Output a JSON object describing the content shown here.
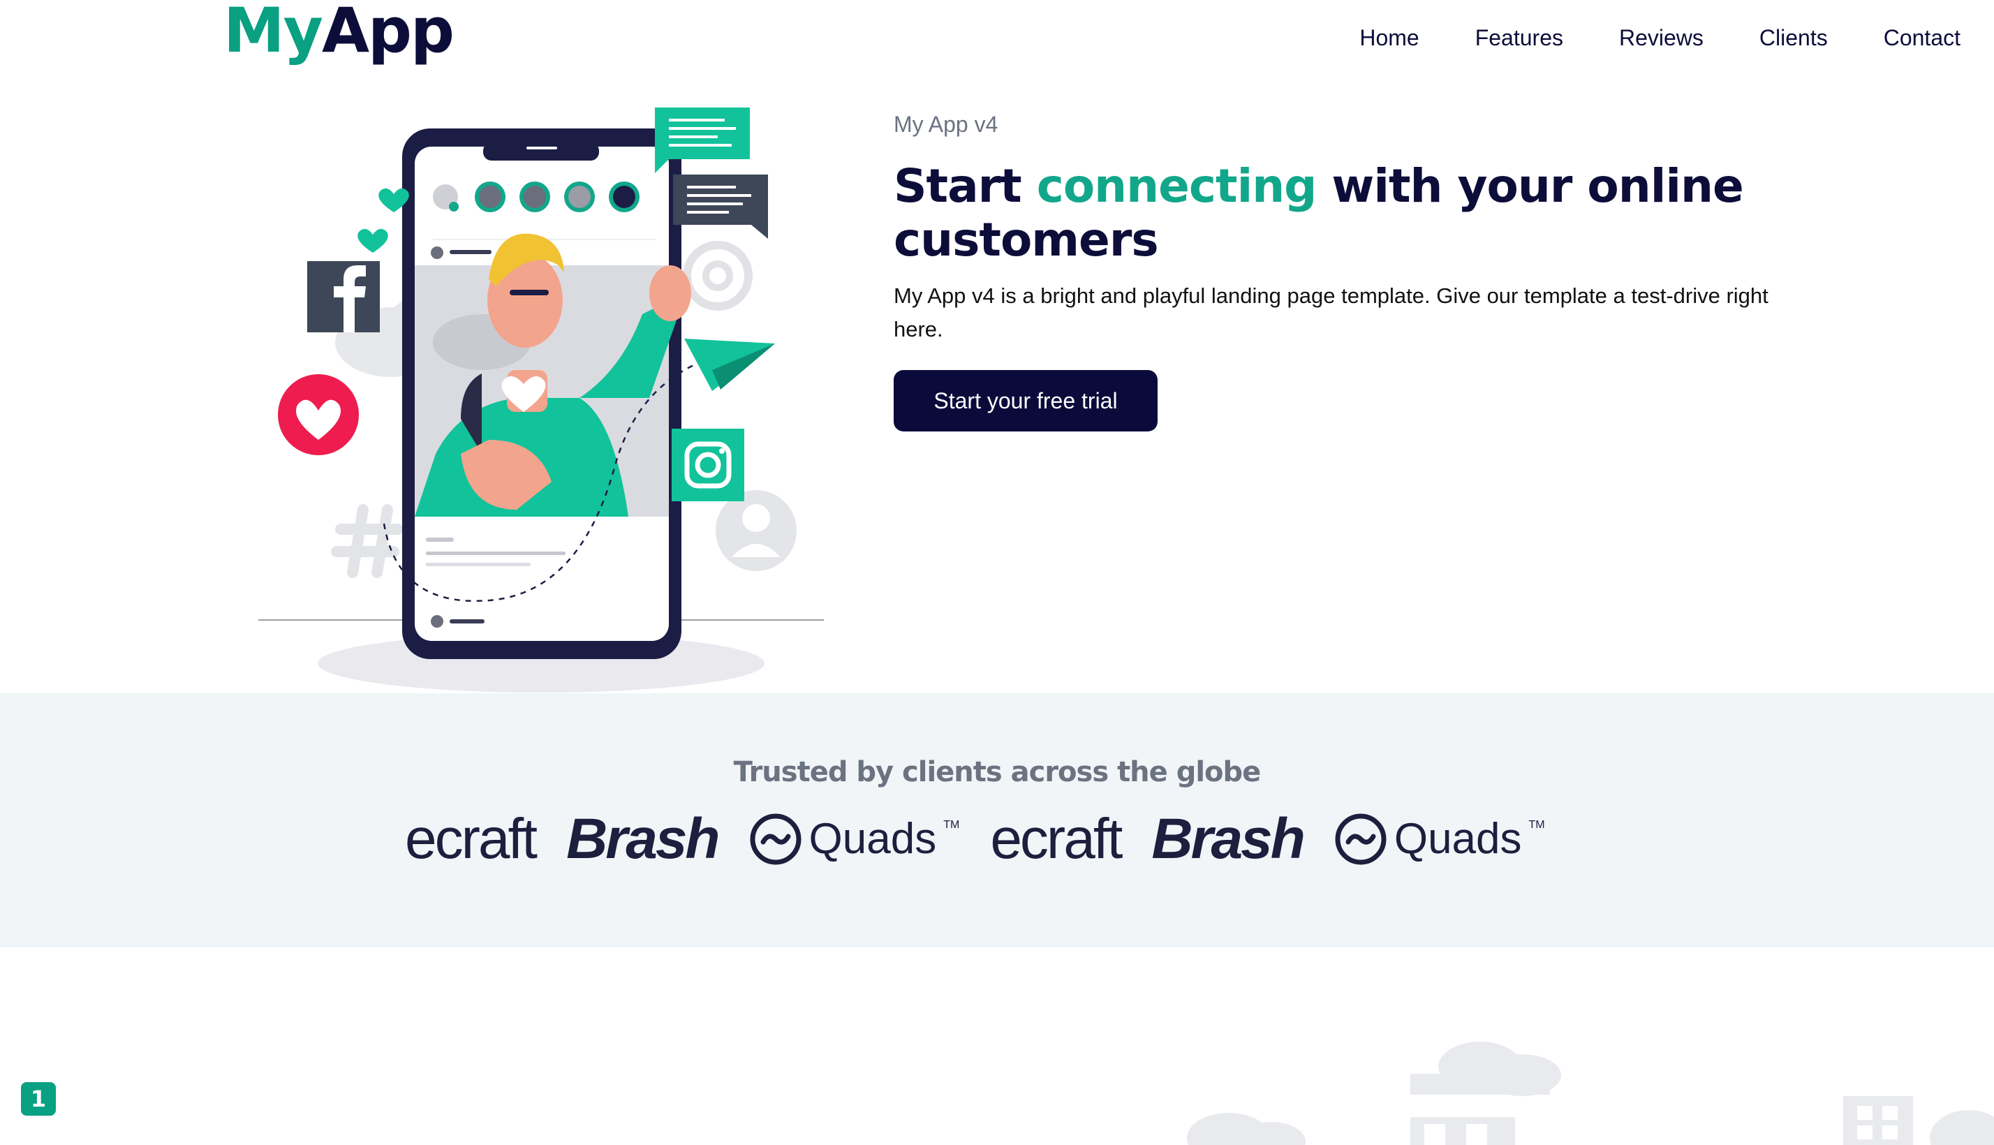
{
  "header": {
    "logo_my": "My",
    "logo_app": "App",
    "nav": [
      "Home",
      "Features",
      "Reviews",
      "Clients",
      "Contact"
    ]
  },
  "hero": {
    "kicker": "My App v4",
    "headline_start": "Start ",
    "headline_accent": "connecting",
    "headline_end": " with your online customers",
    "lead": "My App v4 is a bright and playful landing page template. Give our template a test-drive right here.",
    "cta_label": "Start your free trial"
  },
  "clients": {
    "title": "Trusted by clients across the globe",
    "logos": [
      "ecraft",
      "Brash",
      "Quads",
      "ecraft",
      "Brash",
      "Quads"
    ],
    "trademark": "TM"
  },
  "page_badge": "1",
  "colors": {
    "brand_green": "#0aa082",
    "navy": "#0b0b3b",
    "band_bg": "#f1f5f8",
    "heart_red": "#ee1c4f"
  },
  "icons": [
    "facebook-icon",
    "instagram-icon",
    "heart-icon",
    "at-sign-icon",
    "hashtag-icon",
    "paper-plane-icon",
    "chat-bubble-icon",
    "user-icon"
  ]
}
